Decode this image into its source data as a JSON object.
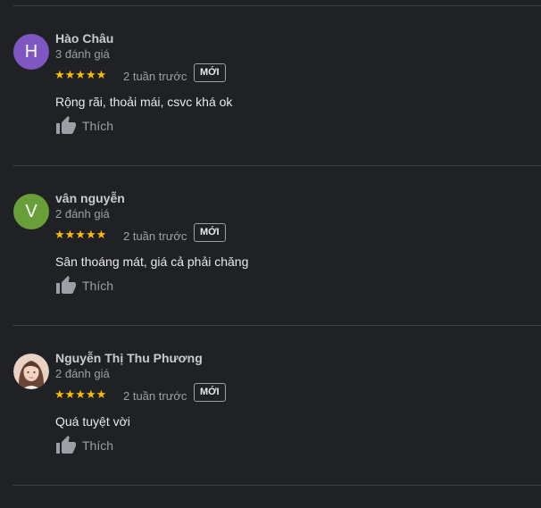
{
  "reviews": [
    {
      "name": "Hào Châu",
      "count": "3 đánh giá",
      "avatar_letter": "H",
      "avatar_color": "#7e57c2",
      "rating": 5,
      "stars": "★★★★★",
      "time": "2 tuần trước",
      "badge": "MỚI",
      "text": "Rộng rãi, thoải mái, csvc khá ok",
      "like_label": "Thích"
    },
    {
      "name": "vân nguyễn",
      "count": "2 đánh giá",
      "avatar_letter": "V",
      "avatar_color": "#689f38",
      "rating": 5,
      "stars": "★★★★★",
      "time": "2 tuần trước",
      "badge": "MỚI",
      "text": "Sân thoáng mát, giá cả phải chăng",
      "like_label": "Thích"
    },
    {
      "name": "Nguyễn Thị Thu Phương",
      "count": "2 đánh giá",
      "avatar_letter": "",
      "avatar_color": "#c9a089",
      "rating": 5,
      "stars": "★★★★★",
      "time": "2 tuần trước",
      "badge": "MỚI",
      "text": "Quá tuyệt vời",
      "like_label": "Thích"
    }
  ],
  "icons": {
    "like": "thumbs-up-icon",
    "star": "star-icon"
  },
  "colors": {
    "background": "#202124",
    "star": "#fbbc04",
    "divider": "#3c4043"
  }
}
